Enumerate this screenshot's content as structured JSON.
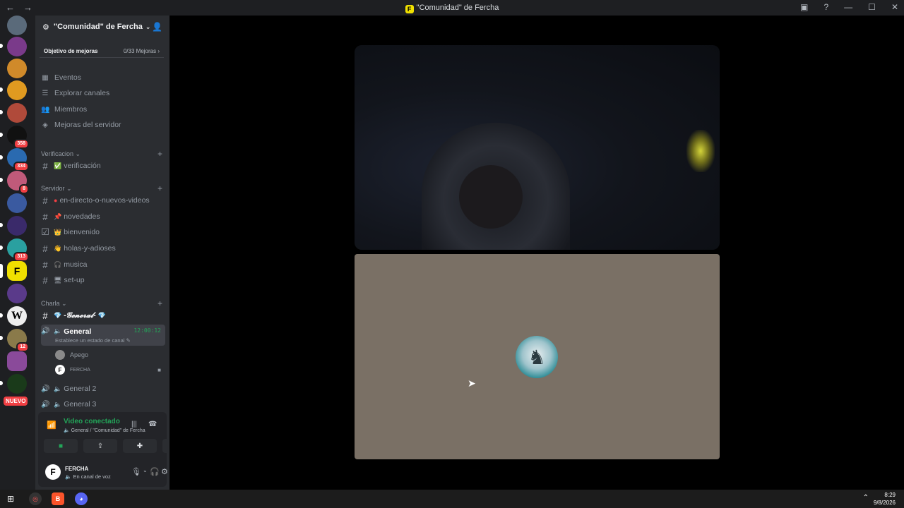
{
  "window": {
    "title": "\"Comunidad\" de Fercha"
  },
  "server": {
    "name": "\"Comunidad\" de Fercha",
    "boost_label": "Objetivo de mejoras",
    "boost_progress": "0/33 Mejoras"
  },
  "menu": [
    "Eventos",
    "Explorar canales",
    "Miembros",
    "Mejoras del servidor"
  ],
  "categories": {
    "verificacion": "Verificacion",
    "servidor": "Servidor",
    "charla": "Charla"
  },
  "channels": {
    "verificacion": "verificación",
    "directo": "en-directo-o-nuevos-videos",
    "novedades": "novedades",
    "bienvenido": "bienvenido",
    "holas": "holas-y-adioses",
    "musica": "musica",
    "setup": "set-up",
    "general_text": "-𝓖𝓮𝓷𝓮𝓻𝓪𝓵-",
    "general_voice": "General",
    "general_timer": "12:00:12",
    "general_status": "Establece un estado de canal",
    "general2": "General 2",
    "general3": "General 3"
  },
  "voice_users": [
    {
      "name": "Apego"
    },
    {
      "name": "FERCHA"
    }
  ],
  "server_badges": [
    "358",
    "334",
    "8",
    "313",
    "12"
  ],
  "nuevo_label": "NUEVO",
  "voice_panel": {
    "title": "Video conectado",
    "subtitle": "General / \"Comunidad\" de Fercha"
  },
  "current_user": {
    "name": "FERCHA",
    "status": "En canal de voz"
  },
  "taskbar": {
    "time": "8:29",
    "date": "9/8/2026"
  },
  "colors": {
    "accent_green": "#23a559",
    "badge_red": "#f23f43",
    "sidebar_bg": "#2b2d31",
    "rail_bg": "#1e1f22"
  }
}
